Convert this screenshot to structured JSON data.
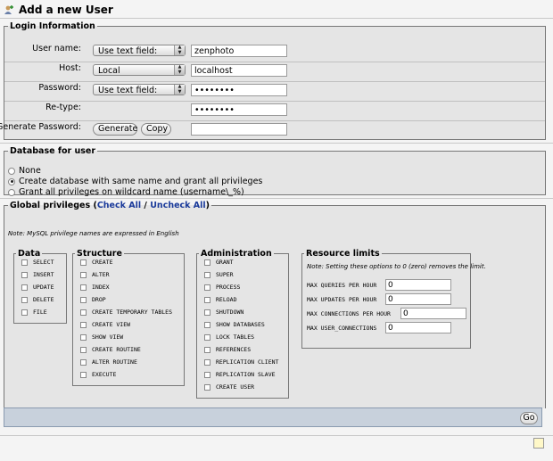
{
  "header": {
    "title": "Add a new User",
    "icon": "add-user-icon"
  },
  "login": {
    "legend": "Login Information",
    "user_name": {
      "label": "User name:",
      "select": "Use text field:",
      "value": "zenphoto"
    },
    "host": {
      "label": "Host:",
      "select": "Local",
      "value": "localhost"
    },
    "password": {
      "label": "Password:",
      "select": "Use text field:",
      "value": "••••••••"
    },
    "retype": {
      "label": "Re-type:",
      "value": "••••••••"
    },
    "generate": {
      "label": "Generate Password:",
      "generate_btn": "Generate",
      "copy_btn": "Copy",
      "value": ""
    }
  },
  "database": {
    "legend": "Database for user",
    "options": [
      {
        "label": "None",
        "selected": false
      },
      {
        "label": "Create database with same name and grant all privileges",
        "selected": true
      },
      {
        "label": "Grant all privileges on wildcard name (username\\_%)",
        "selected": false
      }
    ]
  },
  "global": {
    "legend": "Global privileges",
    "check_all": "Check All",
    "sep": " / ",
    "uncheck_all": "Uncheck All",
    "note": "Note: MySQL privilege names are expressed in English",
    "data": {
      "legend": "Data",
      "items": [
        "SELECT",
        "INSERT",
        "UPDATE",
        "DELETE",
        "FILE"
      ]
    },
    "structure": {
      "legend": "Structure",
      "items": [
        "CREATE",
        "ALTER",
        "INDEX",
        "DROP",
        "CREATE TEMPORARY TABLES",
        "CREATE VIEW",
        "SHOW VIEW",
        "CREATE ROUTINE",
        "ALTER ROUTINE",
        "EXECUTE"
      ]
    },
    "administration": {
      "legend": "Administration",
      "items": [
        "GRANT",
        "SUPER",
        "PROCESS",
        "RELOAD",
        "SHUTDOWN",
        "SHOW DATABASES",
        "LOCK TABLES",
        "REFERENCES",
        "REPLICATION CLIENT",
        "REPLICATION SLAVE",
        "CREATE USER"
      ]
    },
    "resource": {
      "legend": "Resource limits",
      "note": "Note: Setting these options to 0 (zero) removes the limit.",
      "items": [
        {
          "label": "MAX QUERIES PER HOUR",
          "value": "0"
        },
        {
          "label": "MAX UPDATES PER HOUR",
          "value": "0"
        },
        {
          "label": "MAX CONNECTIONS PER HOUR",
          "value": "0"
        },
        {
          "label": "MAX USER_CONNECTIONS",
          "value": "0"
        }
      ]
    }
  },
  "footer": {
    "go_label": "Go"
  }
}
